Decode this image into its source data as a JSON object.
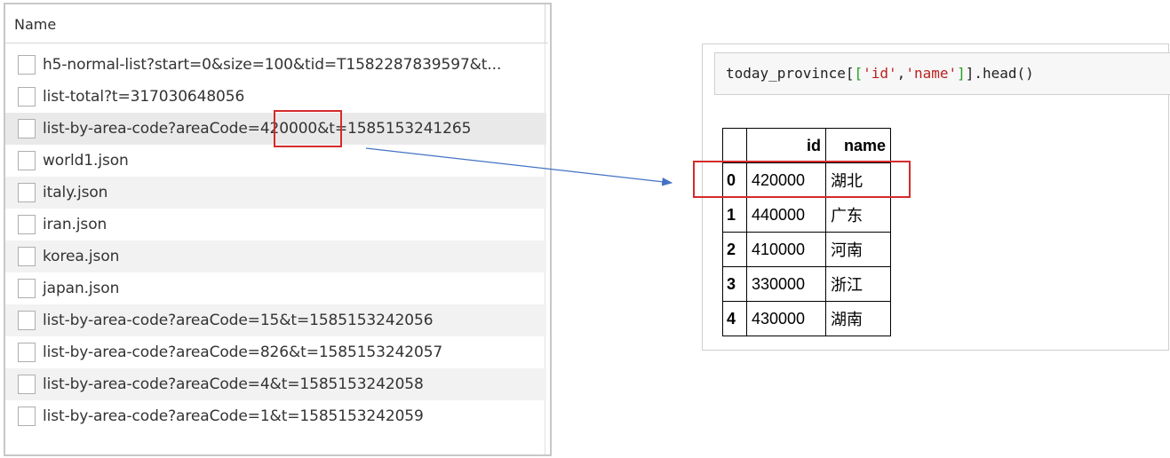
{
  "network": {
    "header": "Name",
    "rows": [
      {
        "label": "h5-normal-list?start=0&size=100&tid=T1582287839597&t..."
      },
      {
        "label": "list-total?t=317030648056"
      },
      {
        "label": "list-by-area-code?areaCode=420000&t=1585153241265"
      },
      {
        "label": "world1.json"
      },
      {
        "label": "italy.json"
      },
      {
        "label": "iran.json"
      },
      {
        "label": "korea.json"
      },
      {
        "label": "japan.json"
      },
      {
        "label": "list-by-area-code?areaCode=15&t=1585153242056"
      },
      {
        "label": "list-by-area-code?areaCode=826&t=1585153242057"
      },
      {
        "label": "list-by-area-code?areaCode=4&t=1585153242058"
      },
      {
        "label": "list-by-area-code?areaCode=1&t=1585153242059"
      }
    ]
  },
  "notebook": {
    "code": {
      "prefix": "today_province[",
      "open": "[",
      "str1": "'id'",
      "comma": ",",
      "str2": "'name'",
      "close": "]",
      "suffix": "].head()"
    },
    "table": {
      "headers": [
        "",
        "id",
        "name"
      ],
      "rows": [
        {
          "index": "0",
          "id": "420000",
          "name": "湖北"
        },
        {
          "index": "1",
          "id": "440000",
          "name": "广东"
        },
        {
          "index": "2",
          "id": "410000",
          "name": "河南"
        },
        {
          "index": "3",
          "id": "330000",
          "name": "浙江"
        },
        {
          "index": "4",
          "id": "430000",
          "name": "湖南"
        }
      ]
    }
  },
  "colors": {
    "highlight": "#d42b2b",
    "arrow": "#4472c4"
  }
}
